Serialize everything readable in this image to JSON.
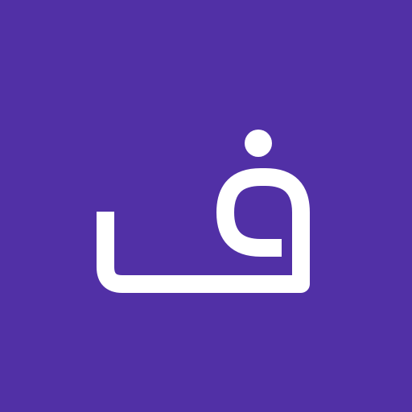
{
  "avatar": {
    "letter": "ف",
    "background_color": "#5130A6",
    "glyph_color": "#FFFFFF"
  }
}
